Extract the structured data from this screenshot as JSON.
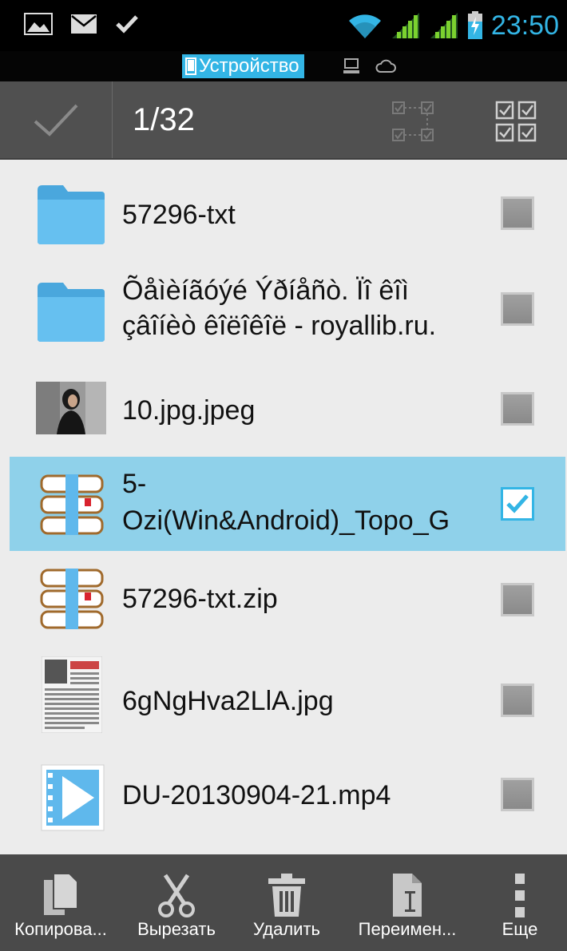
{
  "status_bar": {
    "time": "23:50",
    "left_icons": [
      "image-notification-icon",
      "mail-icon",
      "check-icon"
    ],
    "right_icons": [
      "wifi-icon",
      "signal-1-icon",
      "signal-2-icon",
      "battery-charging-icon"
    ]
  },
  "location_bar": {
    "device_label": "Устройство",
    "other_icons": [
      "network-icon",
      "cloud-icon"
    ]
  },
  "action_bar": {
    "selection_count": "1/32",
    "icons": [
      "done-check-icon",
      "select-range-icon",
      "select-all-icon"
    ]
  },
  "files": [
    {
      "name_lines": [
        "57296-txt"
      ],
      "type": "folder",
      "checked": false
    },
    {
      "name_lines": [
        "Õåìèíãóýé Ýðíåñò. Ïî êîì",
        "çâîíèò êîëîêîë - royallib.ru."
      ],
      "type": "folder",
      "checked": false
    },
    {
      "name_lines": [
        "10.jpg.jpeg"
      ],
      "type": "image",
      "checked": false
    },
    {
      "name_lines": [
        "5-",
        "Ozi(Win&Android)_Topo_G"
      ],
      "type": "archive",
      "checked": true
    },
    {
      "name_lines": [
        "57296-txt.zip"
      ],
      "type": "archive",
      "checked": false
    },
    {
      "name_lines": [
        "6gNgHva2LlA.jpg"
      ],
      "type": "image",
      "checked": false
    },
    {
      "name_lines": [
        "DU-20130904-21.mp4"
      ],
      "type": "video",
      "checked": false
    }
  ],
  "bottom_bar": {
    "copy": "Копирова...",
    "cut": "Вырезать",
    "delete": "Удалить",
    "rename": "Переимен...",
    "more": "Еще"
  },
  "colors": {
    "accent": "#33b5e5",
    "folder": "#5fb8ec",
    "selected_row": "#8fd1ea",
    "action_bar": "#505050",
    "bottom_bar": "#4a4a4a",
    "list_bg": "#ececec"
  }
}
